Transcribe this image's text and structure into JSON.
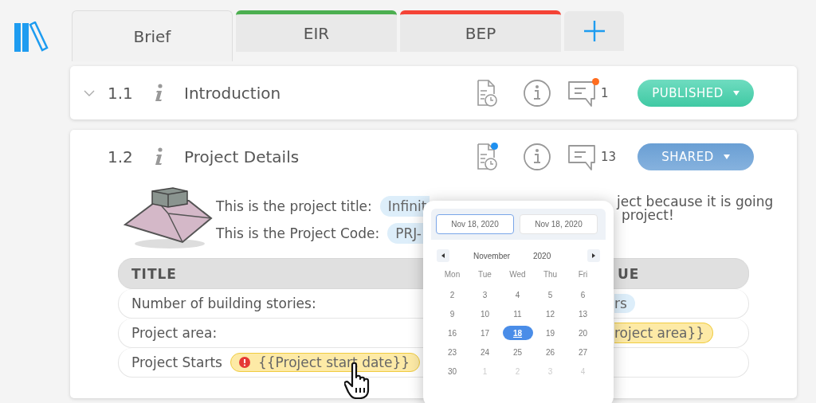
{
  "tabs": [
    {
      "label": "Brief",
      "selected": true
    },
    {
      "label": "EIR",
      "selected": false,
      "color": "#4caf50"
    },
    {
      "label": "BEP",
      "selected": false,
      "color": "#f44336"
    }
  ],
  "sections": [
    {
      "number": "1.1",
      "title": "Introduction",
      "collapsed": true,
      "comment_badge": {
        "color": "#ff6d1f"
      },
      "comments": "1",
      "status": {
        "label": "PUBLISHED",
        "kind": "published"
      }
    },
    {
      "number": "1.2",
      "title": "Project Details",
      "collapsed": false,
      "doc_badge": {
        "color": "#1e90f0"
      },
      "comments": "13",
      "status": {
        "label": "SHARED",
        "kind": "shared"
      }
    }
  ],
  "details": {
    "lines": [
      {
        "label": "This is the project title:",
        "chip": "Infinit",
        "after": "ject because it is going"
      },
      {
        "label": "This is the Project Code:",
        "chip": "PRJ-",
        "after": "project!"
      }
    ],
    "table": {
      "columns": [
        "TITLE",
        "UE"
      ],
      "rows": [
        {
          "title": "Number of building stories:",
          "value": {
            "text": "rs",
            "kind": "value"
          }
        },
        {
          "title": "Project area:",
          "value": {
            "text": "roject area}}",
            "kind": "placeholder"
          }
        },
        {
          "title": "Project Starts",
          "chip": {
            "text": "{{Project start date}}",
            "kind": "placeholder",
            "warning": true
          }
        }
      ]
    }
  },
  "calendar": {
    "inputs": [
      {
        "value": "Nov 18, 2020",
        "focused": true
      },
      {
        "value": "Nov 18, 2020",
        "focused": false
      }
    ],
    "month": "November",
    "year": "2020",
    "weekdays": [
      "Mon",
      "Tue",
      "Wed",
      "Thu",
      "Fri"
    ],
    "days": [
      {
        "label": "2",
        "selected": false,
        "disabled": false
      },
      {
        "label": "3",
        "selected": false,
        "disabled": false
      },
      {
        "label": "4",
        "selected": false,
        "disabled": false
      },
      {
        "label": "5",
        "selected": false,
        "disabled": false
      },
      {
        "label": "6",
        "selected": false,
        "disabled": false
      },
      {
        "label": "9",
        "selected": false,
        "disabled": false
      },
      {
        "label": "10",
        "selected": false,
        "disabled": false
      },
      {
        "label": "11",
        "selected": false,
        "disabled": false
      },
      {
        "label": "12",
        "selected": false,
        "disabled": false
      },
      {
        "label": "13",
        "selected": false,
        "disabled": false
      },
      {
        "label": "16",
        "selected": false,
        "disabled": false
      },
      {
        "label": "17",
        "selected": false,
        "disabled": false
      },
      {
        "label": "18",
        "selected": true,
        "disabled": false
      },
      {
        "label": "19",
        "selected": false,
        "disabled": false
      },
      {
        "label": "20",
        "selected": false,
        "disabled": false
      },
      {
        "label": "23",
        "selected": false,
        "disabled": false
      },
      {
        "label": "24",
        "selected": false,
        "disabled": false
      },
      {
        "label": "25",
        "selected": false,
        "disabled": false
      },
      {
        "label": "26",
        "selected": false,
        "disabled": false
      },
      {
        "label": "27",
        "selected": false,
        "disabled": false
      },
      {
        "label": "30",
        "selected": false,
        "disabled": false
      },
      {
        "label": "1",
        "selected": false,
        "disabled": true
      },
      {
        "label": "2",
        "selected": false,
        "disabled": true
      },
      {
        "label": "3",
        "selected": false,
        "disabled": true
      },
      {
        "label": "4",
        "selected": false,
        "disabled": true
      }
    ]
  }
}
